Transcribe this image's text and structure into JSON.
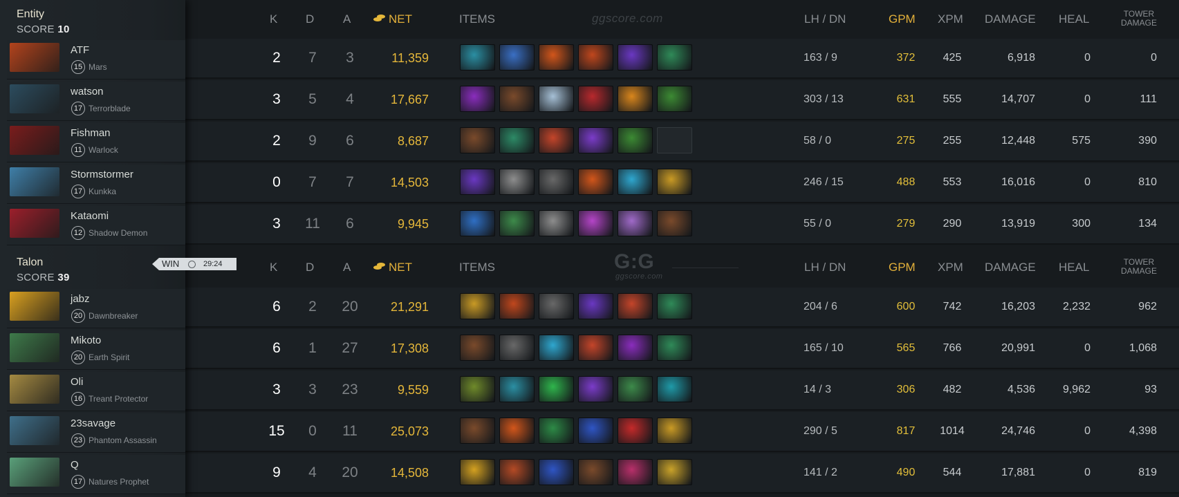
{
  "colors": {
    "gold": "#e5b73a",
    "gpm": "#e3bf3a",
    "header": "#8a8e92"
  },
  "watermark": {
    "top": "ggscore.com",
    "logo": "G:G",
    "logo_sub": "ggscore.com"
  },
  "columns": {
    "k": "K",
    "d": "D",
    "a": "A",
    "net": "NET",
    "items": "ITEMS",
    "lh": "LH  /  DN",
    "gpm": "GPM",
    "xpm": "XPM",
    "damage": "DAMAGE",
    "heal": "HEAL",
    "tower": "TOWER DAMAGE",
    "tower_line1": "TOWER",
    "tower_line2": "DAMAGE",
    "net_icon": "gold-coins-icon"
  },
  "result": {
    "label": "WIN",
    "time": "29:24",
    "icon": "clock-icon"
  },
  "teams": [
    {
      "name": "Entity",
      "score_label": "SCORE",
      "score": "10",
      "players": [
        {
          "name": "ATF",
          "level": "15",
          "hero": "Mars",
          "k": "2",
          "d": "7",
          "a": "3",
          "net": "11,359",
          "lh": "163  /  9",
          "gpm": "372",
          "xpm": "425",
          "damage": "6,918",
          "heal": "0",
          "tower": "0",
          "portrait": "#b2431c",
          "items": [
            "#2b8fa3",
            "#3a6fc4",
            "#d2561b",
            "#c0471d",
            "#6a38c2",
            "#2f8a58"
          ]
        },
        {
          "name": "watson",
          "level": "17",
          "hero": "Terrorblade",
          "k": "3",
          "d": "5",
          "a": "4",
          "net": "17,667",
          "lh": "303  /  13",
          "gpm": "631",
          "xpm": "555",
          "damage": "14,707",
          "heal": "0",
          "tower": "111",
          "portrait": "#2c4c5e",
          "items": [
            "#8a2dbd",
            "#7a4a2b",
            "#a6c0d6",
            "#b8292d",
            "#d9861c",
            "#3c8a33"
          ]
        },
        {
          "name": "Fishman",
          "level": "11",
          "hero": "Warlock",
          "k": "2",
          "d": "9",
          "a": "6",
          "net": "8,687",
          "lh": "58  /  0",
          "gpm": "275",
          "xpm": "255",
          "damage": "12,448",
          "heal": "575",
          "tower": "390",
          "portrait": "#7a1c1c",
          "items": [
            "#7a4a2b",
            "#2d8a66",
            "#c4452a",
            "#7b3cc9",
            "#3c8a33",
            ""
          ]
        },
        {
          "name": "Stormstormer",
          "level": "17",
          "hero": "Kunkka",
          "k": "0",
          "d": "7",
          "a": "7",
          "net": "14,503",
          "lh": "246  /  15",
          "gpm": "488",
          "xpm": "553",
          "damage": "16,016",
          "heal": "0",
          "tower": "810",
          "portrait": "#3f7fa8",
          "items": [
            "#6a38c2",
            "#8d8d8d",
            "#686868",
            "#d2561b",
            "#2fa7cf",
            "#c99a25"
          ]
        },
        {
          "name": "Kataomi",
          "level": "12",
          "hero": "Shadow Demon",
          "k": "3",
          "d": "11",
          "a": "6",
          "net": "9,945",
          "lh": "55  /  0",
          "gpm": "279",
          "xpm": "290",
          "damage": "13,919",
          "heal": "300",
          "tower": "134",
          "portrait": "#9b1f2b",
          "items": [
            "#2f6fc4",
            "#3d8a4a",
            "#8d8d8d",
            "#b545c8",
            "#a06ac9",
            "#7a4a2b"
          ]
        }
      ]
    },
    {
      "name": "Talon",
      "score_label": "SCORE",
      "score": "39",
      "players": [
        {
          "name": "jabz",
          "level": "20",
          "hero": "Dawnbreaker",
          "k": "6",
          "d": "2",
          "a": "20",
          "net": "21,291",
          "lh": "204  /  6",
          "gpm": "600",
          "xpm": "742",
          "damage": "16,203",
          "heal": "2,232",
          "tower": "962",
          "portrait": "#d9a020",
          "items": [
            "#c99a25",
            "#c0471d",
            "#686868",
            "#6a38c2",
            "#c4452a",
            "#2f8a58"
          ]
        },
        {
          "name": "Mikoto",
          "level": "20",
          "hero": "Earth Spirit",
          "k": "6",
          "d": "1",
          "a": "27",
          "net": "17,308",
          "lh": "165  /  10",
          "gpm": "565",
          "xpm": "766",
          "damage": "20,991",
          "heal": "0",
          "tower": "1,068",
          "portrait": "#3e7a4a",
          "items": [
            "#7a4a2b",
            "#686868",
            "#2fa7cf",
            "#c4452a",
            "#8a2dbd",
            "#2f8a58"
          ]
        },
        {
          "name": "Oli",
          "level": "16",
          "hero": "Treant Protector",
          "k": "3",
          "d": "3",
          "a": "23",
          "net": "9,559",
          "lh": "14  /  3",
          "gpm": "306",
          "xpm": "482",
          "damage": "4,536",
          "heal": "9,962",
          "tower": "93",
          "portrait": "#a48a42",
          "items": [
            "#6f8a2a",
            "#2b8fa3",
            "#2fb54c",
            "#7b3cc9",
            "#3d8a4a",
            "#1f9aa8"
          ]
        },
        {
          "name": "23savage",
          "level": "23",
          "hero": "Phantom Assassin",
          "k": "15",
          "d": "0",
          "a": "11",
          "net": "25,073",
          "lh": "290  /  5",
          "gpm": "817",
          "xpm": "1014",
          "damage": "24,746",
          "heal": "0",
          "tower": "4,398",
          "portrait": "#3f6f8a",
          "items": [
            "#7a4a2b",
            "#d2561b",
            "#2d8a46",
            "#2f55c4",
            "#c42a2a",
            "#c99a25"
          ]
        },
        {
          "name": "Q",
          "level": "17",
          "hero": "Natures Prophet",
          "k": "9",
          "d": "4",
          "a": "20",
          "net": "14,508",
          "lh": "141  /  2",
          "gpm": "490",
          "xpm": "544",
          "damage": "17,881",
          "heal": "0",
          "tower": "819",
          "portrait": "#5aa07a",
          "items": [
            "#d4a120",
            "#b44a25",
            "#2f55c4",
            "#7a4a2b",
            "#b8306a",
            "#c9a22a"
          ]
        }
      ]
    }
  ]
}
